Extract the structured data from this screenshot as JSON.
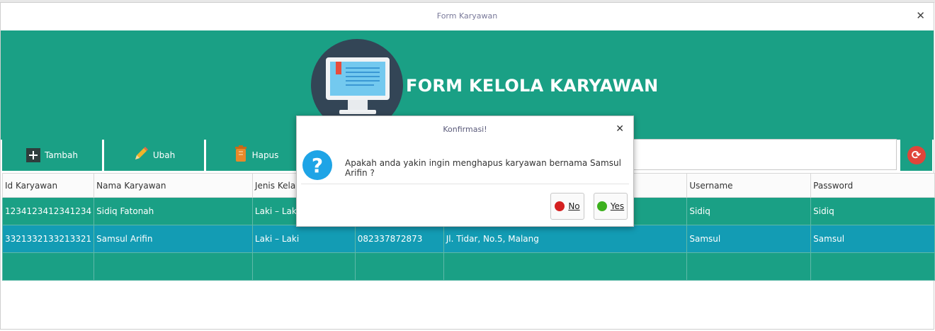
{
  "window": {
    "title": "Form Karyawan",
    "close_icon": "close-icon"
  },
  "header": {
    "title": "FORM KELOLA KARYAWAN"
  },
  "toolbar": {
    "buttons": [
      {
        "label": "Tambah",
        "icon": "plus-icon"
      },
      {
        "label": "Ubah",
        "icon": "pencil-icon"
      },
      {
        "label": "Hapus",
        "icon": "trash-icon"
      }
    ],
    "search_value": "",
    "refresh_icon": "refresh-icon"
  },
  "table": {
    "columns": [
      "Id Karyawan",
      "Nama Karyawan",
      "Jenis Kelam",
      "",
      "",
      "Username",
      "Password"
    ],
    "rows": [
      [
        "1234123412341234",
        "Sidiq Fatonah",
        "Laki – Laki",
        "",
        "",
        "Sidiq",
        "Sidiq"
      ],
      [
        "3321332133213321",
        "Samsul Arifin",
        "Laki – Laki",
        "082337872873",
        "Jl. Tidar, No.5, Malang",
        "Samsul",
        "Samsul"
      ],
      [
        "",
        "",
        "",
        "",
        "",
        "",
        ""
      ]
    ]
  },
  "dialog": {
    "title": "Konfirmasi!",
    "message": "Apakah anda yakin ingin menghapus karyawan bernama Samsul Arifin ?",
    "no_label": "No",
    "yes_label": "Yes",
    "colors": {
      "no": "#d42020",
      "yes": "#3cb01e"
    }
  },
  "colors": {
    "accent": "#1aa085",
    "selected_row": "#139cb4"
  }
}
